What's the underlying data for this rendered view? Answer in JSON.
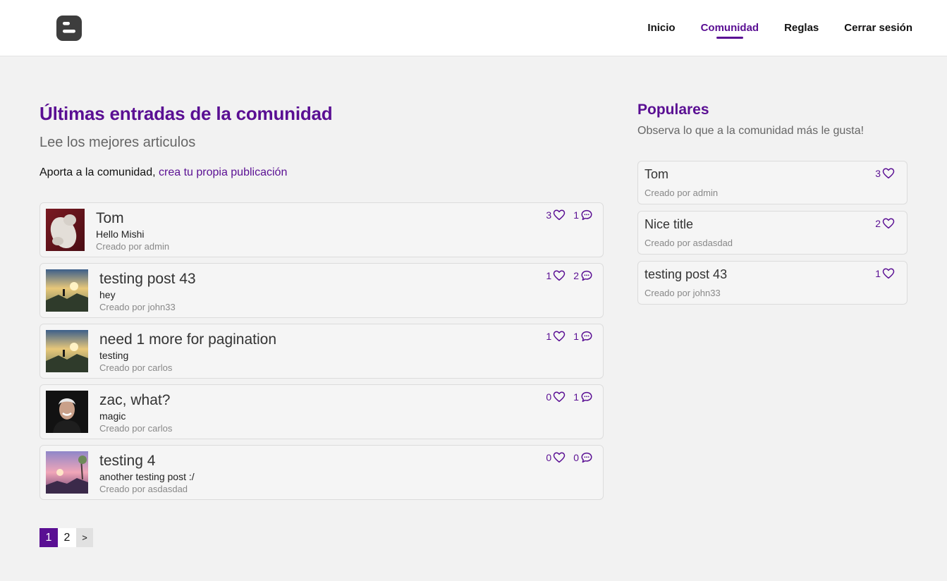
{
  "header": {
    "nav": [
      "Inicio",
      "Comunidad",
      "Reglas",
      "Cerrar sesión"
    ],
    "active_nav": "Comunidad"
  },
  "main": {
    "title": "Últimas entradas de la comunidad",
    "subtitle": "Lee los mejores articulos",
    "contribute_text": "Aporta a la comunidad,",
    "contribute_link": "crea tu propia publicación",
    "posts": [
      {
        "title": "Tom",
        "description": "Hello Mishi",
        "author": "Creado por admin",
        "likes": "3",
        "comments": "1",
        "thumbnail": "white-cat-photo"
      },
      {
        "title": "testing post 43",
        "description": "hey",
        "author": "Creado por john33",
        "likes": "1",
        "comments": "2",
        "thumbnail": "sunset-landscape-photo"
      },
      {
        "title": "need 1 more for pagination",
        "description": "testing",
        "author": "Creado por carlos",
        "likes": "1",
        "comments": "1",
        "thumbnail": "sunset-landscape-photo"
      },
      {
        "title": "zac, what?",
        "description": "magic",
        "author": "Creado por carlos",
        "likes": "0",
        "comments": "1",
        "thumbnail": "person-portrait-photo"
      },
      {
        "title": "testing 4",
        "description": "another testing post :/",
        "author": "Creado por asdasdad",
        "likes": "0",
        "comments": "0",
        "thumbnail": "pink-sky-landscape-photo"
      }
    ]
  },
  "pagination": {
    "pages": [
      "1",
      "2"
    ],
    "current": "1",
    "next_label": ">"
  },
  "sidebar": {
    "title": "Populares",
    "subtitle": "Observa lo que a la comunidad más le gusta!",
    "items": [
      {
        "title": "Tom",
        "author": "Creado por admin",
        "likes": "3"
      },
      {
        "title": "Nice title",
        "author": "Creado por asdasdad",
        "likes": "2"
      },
      {
        "title": "testing post 43",
        "author": "Creado por john33",
        "likes": "1"
      }
    ]
  },
  "colors": {
    "accent": "#5a0f93",
    "background": "#f2f2f2",
    "card": "#f5f5f5",
    "header": "#ffffff"
  }
}
